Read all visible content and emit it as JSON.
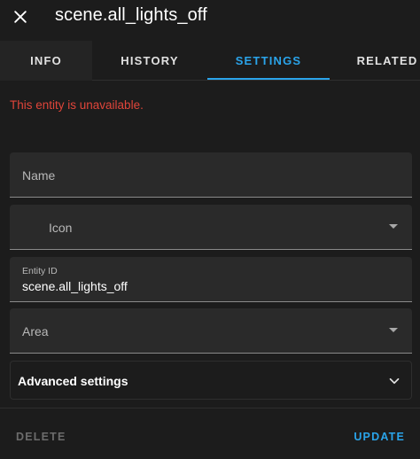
{
  "header": {
    "title": "scene.all_lights_off",
    "close_icon": "close-icon"
  },
  "tabs": [
    {
      "label": "INFO"
    },
    {
      "label": "HISTORY"
    },
    {
      "label": "SETTINGS",
      "active": true
    },
    {
      "label": "RELATED"
    }
  ],
  "error_message": "This entity is unavailable.",
  "fields": {
    "name": {
      "label": "Name",
      "value": ""
    },
    "icon": {
      "label": "Icon",
      "value": ""
    },
    "entity_id": {
      "label": "Entity ID",
      "value": "scene.all_lights_off"
    },
    "area": {
      "label": "Area",
      "value": ""
    }
  },
  "advanced": {
    "label": "Advanced settings",
    "icon": "chevron-down-icon"
  },
  "footer": {
    "delete_label": "DELETE",
    "update_label": "UPDATE"
  },
  "colors": {
    "accent": "#2aa4ea",
    "error": "#e0453a",
    "background": "#1c1c1c",
    "field_bg": "#2a2a2a"
  }
}
